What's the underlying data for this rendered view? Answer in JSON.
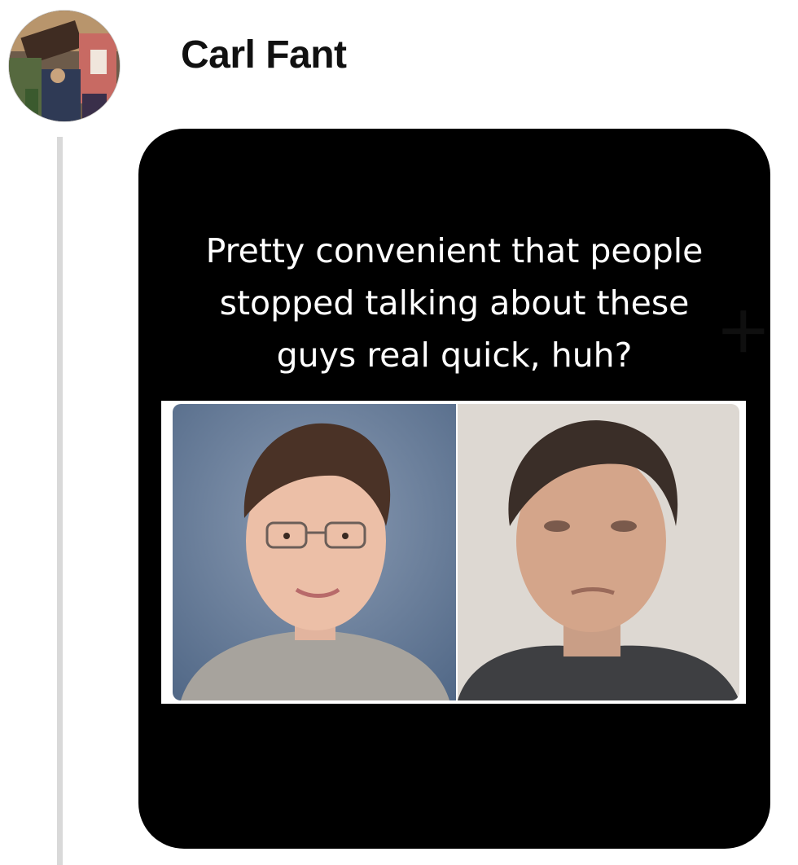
{
  "post": {
    "author": {
      "name": "Carl Fant",
      "avatar_icon": "profile-photo"
    },
    "media": {
      "caption_lines": [
        "Pretty convenient that people",
        "stopped talking about these",
        "guys real quick, huh?"
      ],
      "background_color": "#000000",
      "photos": [
        {
          "icon": "portrait-young-man-glasses"
        },
        {
          "icon": "portrait-mugshot-man"
        }
      ]
    }
  },
  "colors": {
    "thread_line": "#d9d9d9",
    "name_text": "#111111",
    "caption_text": "#ffffff"
  }
}
